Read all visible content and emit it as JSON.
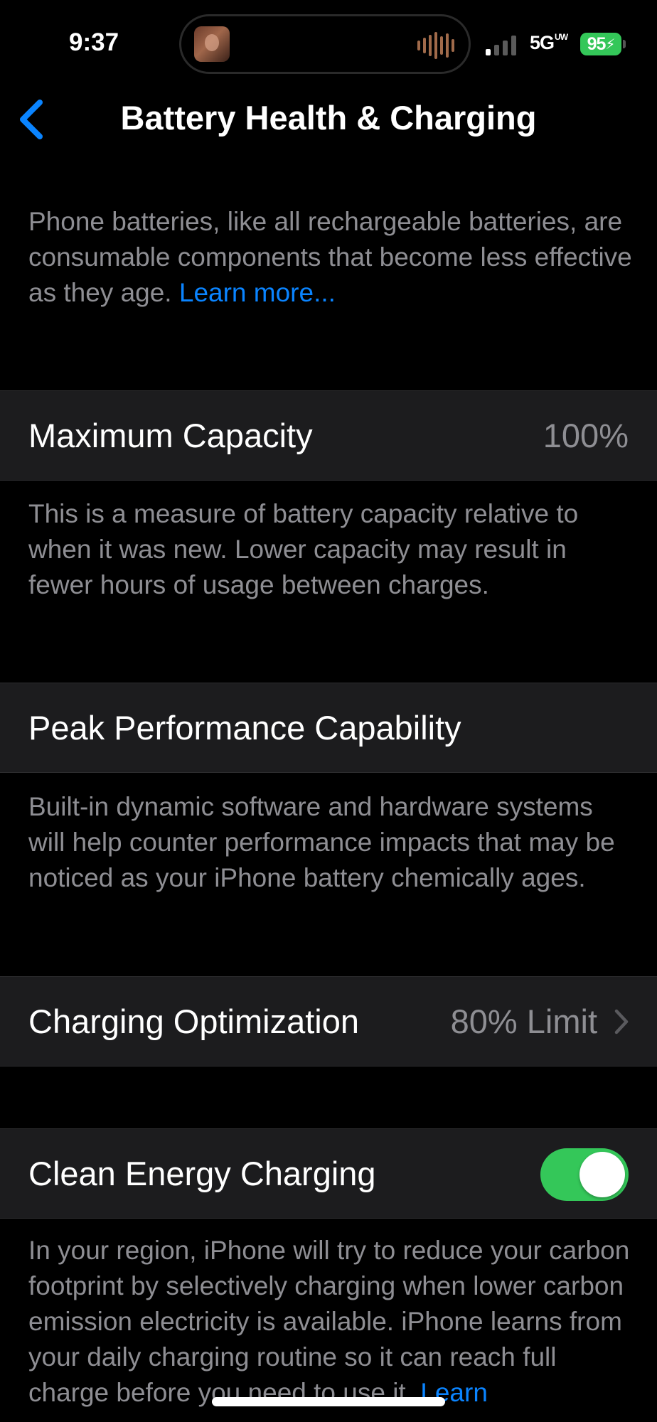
{
  "status_bar": {
    "time": "9:37",
    "network": "5G",
    "network_sub": "UW",
    "battery_percent": "95",
    "battery_charging": true,
    "signal_bars_active": 1,
    "signal_bars_total": 4
  },
  "nav": {
    "back_icon": "chevron-left-icon",
    "title": "Battery Health & Charging"
  },
  "intro": {
    "text": "Phone batteries, like all rechargeable batteries, are consumable components that become less effective as they age.",
    "link": "Learn more..."
  },
  "maximum_capacity": {
    "label": "Maximum Capacity",
    "value": "100%",
    "description": "This is a measure of battery capacity relative to when it was new. Lower capacity may result in fewer hours of usage between charges."
  },
  "peak_performance": {
    "label": "Peak Performance Capability",
    "description": "Built-in dynamic software and hardware systems will help counter performance impacts that may be noticed as your iPhone battery chemically ages."
  },
  "charging_optimization": {
    "label": "Charging Optimization",
    "value": "80% Limit",
    "icon": "chevron-right-icon"
  },
  "clean_energy": {
    "label": "Clean Energy Charging",
    "enabled": true,
    "description": "In your region, iPhone will try to reduce your carbon footprint by selectively charging when lower carbon emission electricity is available. iPhone learns from your daily charging routine so it can reach full charge before you need to use it.",
    "link": "Learn"
  },
  "colors": {
    "background": "#000000",
    "cell": "#1c1c1e",
    "secondary_text": "#8e8e93",
    "accent": "#0a84ff",
    "toggle_on": "#34c759"
  }
}
